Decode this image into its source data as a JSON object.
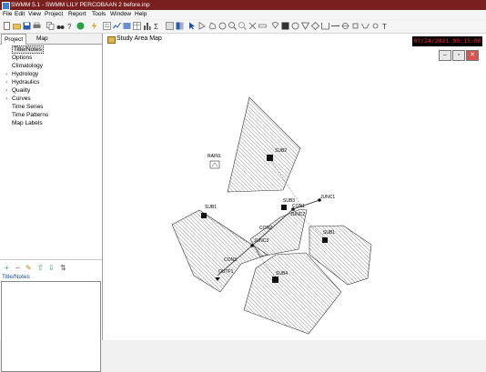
{
  "app": {
    "title": "SWMM 5.1 - SWMM LILY PERCOBAAN 2 before.inp"
  },
  "menu": [
    "File",
    "Edit",
    "View",
    "Project",
    "Report",
    "Tools",
    "Window",
    "Help"
  ],
  "left_panel": {
    "tabs": [
      "Project",
      "Map"
    ],
    "tree": [
      {
        "label": "Title/Notes",
        "expandable": false,
        "selected": true
      },
      {
        "label": "Options",
        "expandable": false
      },
      {
        "label": "Climatology",
        "expandable": false
      },
      {
        "label": "Hydrology",
        "expandable": true
      },
      {
        "label": "Hydraulics",
        "expandable": true
      },
      {
        "label": "Quality",
        "expandable": true
      },
      {
        "label": "Curves",
        "expandable": true
      },
      {
        "label": "Time Series",
        "expandable": false
      },
      {
        "label": "Time Patterns",
        "expandable": false
      },
      {
        "label": "Map Labels",
        "expandable": false
      }
    ],
    "notes_label": "Title/Notes"
  },
  "map_window": {
    "title": "Study Area Map",
    "clock": "07/24/2021 00:15:00",
    "buttons": [
      "–",
      "▫",
      "✕"
    ]
  },
  "map": {
    "rain": "RAIN1",
    "subcatchments": [
      "SUB2",
      "SUB1",
      "SUB3",
      "SUB4",
      "SUB1"
    ],
    "junctions": [
      "JUNC1",
      "JUNC2",
      "JUNC3"
    ],
    "conduits": [
      "CON1",
      "CON2",
      "CON3"
    ],
    "outfall": "OUTF1"
  },
  "colors": {
    "titlebar": "#7a1f1f",
    "clock_text": "#ff2020"
  }
}
